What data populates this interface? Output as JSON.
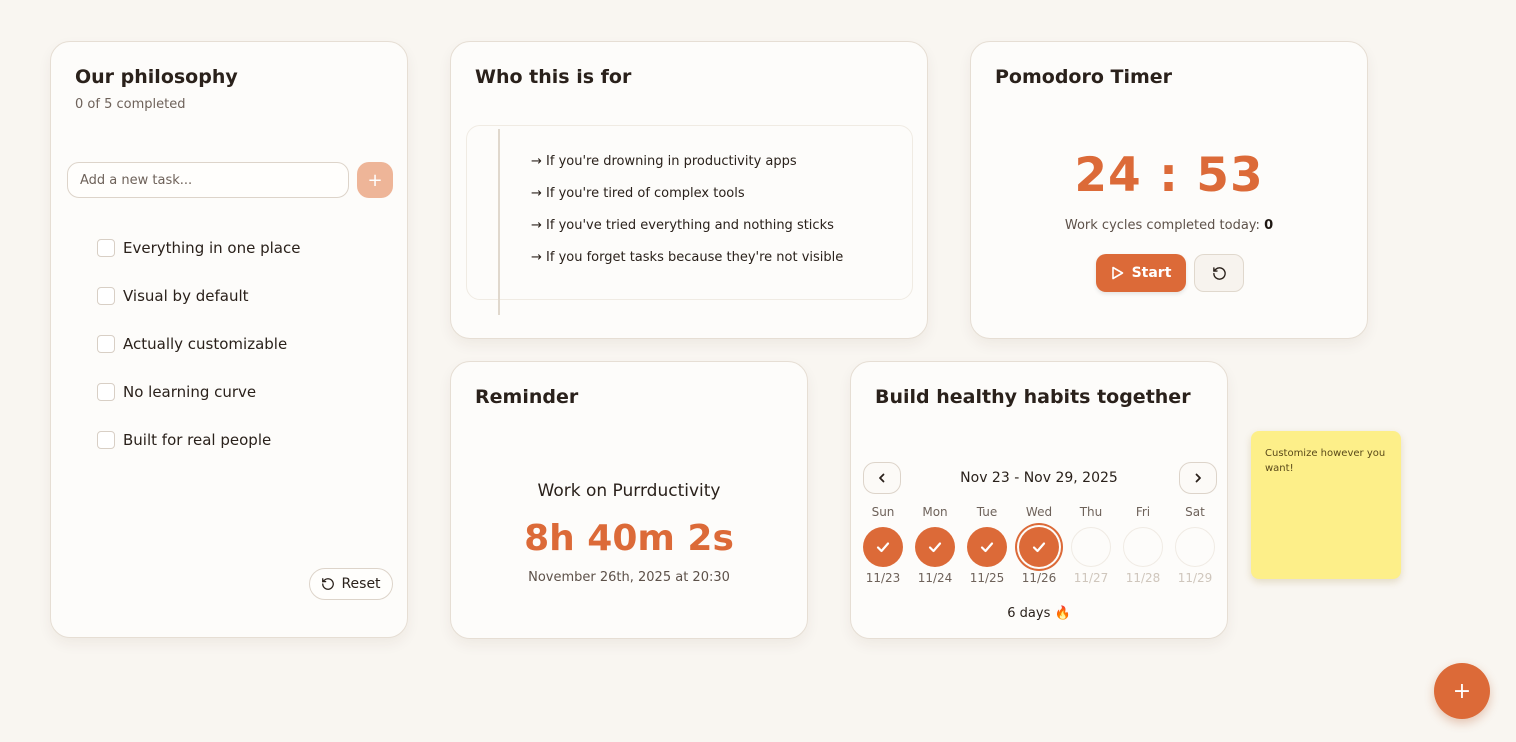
{
  "philosophy": {
    "title": "Our philosophy",
    "subtitle": "0 of 5 completed",
    "input_placeholder": "Add a new task...",
    "add_icon": "plus-icon",
    "items": [
      {
        "label": "Everything in one place",
        "checked": false
      },
      {
        "label": "Visual by default",
        "checked": false
      },
      {
        "label": "Actually customizable",
        "checked": false
      },
      {
        "label": "No learning curve",
        "checked": false
      },
      {
        "label": "Built for real people",
        "checked": false
      }
    ],
    "reset_label": "Reset",
    "reset_icon": "rotate-ccw-icon"
  },
  "who": {
    "title": "Who this is for",
    "items": [
      "→ If you're drowning in productivity apps",
      "→ If you're tired of complex tools",
      "→ If you've tried everything and nothing sticks",
      "→ If you forget tasks because they're not visible"
    ]
  },
  "pomodoro": {
    "title": "Pomodoro Timer",
    "time": "24 : 53",
    "cycles_label": "Work cycles completed today:",
    "cycles_value": "0",
    "start_label": "Start",
    "start_icon": "play-icon",
    "restart_icon": "rotate-ccw-icon"
  },
  "reminder": {
    "title": "Reminder",
    "task": "Work on Purrductivity",
    "countdown": "8h 40m 2s",
    "datetime": "November 26th, 2025 at 20:30"
  },
  "habits": {
    "title": "Build healthy habits together",
    "range": "Nov 23 - Nov 29, 2025",
    "prev_icon": "chevron-left-icon",
    "next_icon": "chevron-right-icon",
    "days": [
      {
        "name": "Sun",
        "date": "11/23",
        "state": "done"
      },
      {
        "name": "Mon",
        "date": "11/24",
        "state": "done"
      },
      {
        "name": "Tue",
        "date": "11/25",
        "state": "done"
      },
      {
        "name": "Wed",
        "date": "11/26",
        "state": "today-done"
      },
      {
        "name": "Thu",
        "date": "11/27",
        "state": "future"
      },
      {
        "name": "Fri",
        "date": "11/28",
        "state": "future"
      },
      {
        "name": "Sat",
        "date": "11/29",
        "state": "future"
      }
    ],
    "streak": "6 days 🔥"
  },
  "sticky": {
    "text": "Customize however you want!"
  },
  "fab": {
    "icon": "plus-icon"
  },
  "colors": {
    "accent": "#dc6a38",
    "background": "#f9f6f1",
    "card": "#fdfcfa",
    "sticky": "#fdef89"
  }
}
